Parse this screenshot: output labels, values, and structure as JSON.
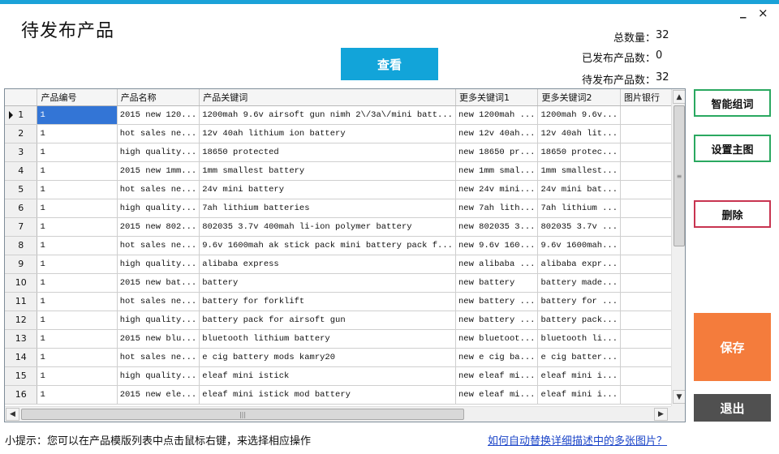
{
  "window": {
    "minimize_glyph": "_",
    "close_glyph": "×"
  },
  "page": {
    "title": "待发布产品"
  },
  "toolbar": {
    "view_label": "查看"
  },
  "stats": {
    "total_label": "总数量：",
    "total_value": "32",
    "published_label": "已发布产品数：",
    "published_value": "0",
    "pending_label": "待发布产品数：",
    "pending_value": "32"
  },
  "grid": {
    "columns": [
      "产品编号",
      "产品名称",
      "产品关键词",
      "更多关键词1",
      "更多关键词2",
      "图片银行"
    ],
    "current_row_icon": "row-pointer-icon",
    "rows": [
      {
        "num": "1",
        "id": "1",
        "name": "2015 new 120...",
        "kw": "1200mah 9.6v airsoft gun nimh 2\\/3a\\/mini batt...",
        "kw1": "new 1200mah ...",
        "kw2": "1200mah 9.6v...",
        "img": ""
      },
      {
        "num": "2",
        "id": "1",
        "name": "hot sales ne...",
        "kw": "12v 40ah lithium ion battery",
        "kw1": "new 12v 40ah...",
        "kw2": "12v 40ah lit...",
        "img": ""
      },
      {
        "num": "3",
        "id": "1",
        "name": "high quality...",
        "kw": "18650 protected",
        "kw1": "new 18650 pr...",
        "kw2": "18650 protec...",
        "img": ""
      },
      {
        "num": "4",
        "id": "1",
        "name": "2015 new 1mm...",
        "kw": "1mm smallest battery",
        "kw1": "new 1mm smal...",
        "kw2": "1mm smallest...",
        "img": ""
      },
      {
        "num": "5",
        "id": "1",
        "name": "hot sales ne...",
        "kw": "24v mini battery",
        "kw1": "new 24v mini...",
        "kw2": "24v mini bat...",
        "img": ""
      },
      {
        "num": "6",
        "id": "1",
        "name": "high quality...",
        "kw": "7ah lithium batteries",
        "kw1": "new 7ah lith...",
        "kw2": "7ah lithium ...",
        "img": ""
      },
      {
        "num": "7",
        "id": "1",
        "name": "2015 new 802...",
        "kw": "802035 3.7v 400mah li-ion polymer battery",
        "kw1": "new 802035 3...",
        "kw2": "802035 3.7v ...",
        "img": ""
      },
      {
        "num": "8",
        "id": "1",
        "name": "hot sales ne...",
        "kw": "9.6v 1600mah ak stick pack mini battery pack f...",
        "kw1": "new 9.6v 160...",
        "kw2": "9.6v 1600mah...",
        "img": ""
      },
      {
        "num": "9",
        "id": "1",
        "name": "high quality...",
        "kw": "alibaba express",
        "kw1": "new alibaba ...",
        "kw2": "alibaba expr...",
        "img": ""
      },
      {
        "num": "10",
        "id": "1",
        "name": "2015 new bat...",
        "kw": "battery",
        "kw1": "new battery",
        "kw2": "battery made...",
        "img": ""
      },
      {
        "num": "11",
        "id": "1",
        "name": "hot sales ne...",
        "kw": "battery for forklift",
        "kw1": "new battery ...",
        "kw2": "battery for ...",
        "img": ""
      },
      {
        "num": "12",
        "id": "1",
        "name": "high quality...",
        "kw": "battery pack for airsoft gun",
        "kw1": "new battery ...",
        "kw2": "battery pack...",
        "img": ""
      },
      {
        "num": "13",
        "id": "1",
        "name": "2015 new blu...",
        "kw": "bluetooth lithium battery",
        "kw1": "new bluetoot...",
        "kw2": "bluetooth li...",
        "img": ""
      },
      {
        "num": "14",
        "id": "1",
        "name": "hot sales ne...",
        "kw": "e cig battery mods kamry20",
        "kw1": "new e cig ba...",
        "kw2": "e cig batter...",
        "img": ""
      },
      {
        "num": "15",
        "id": "1",
        "name": "high quality...",
        "kw": "eleaf mini istick",
        "kw1": "new eleaf mi...",
        "kw2": "eleaf mini i...",
        "img": ""
      },
      {
        "num": "16",
        "id": "1",
        "name": "2015 new ele...",
        "kw": "eleaf mini istick mod battery",
        "kw1": "new eleaf mi...",
        "kw2": "eleaf mini i...",
        "img": ""
      }
    ]
  },
  "scrollbars": {
    "up_glyph": "▲",
    "down_glyph": "▼",
    "left_glyph": "◀",
    "right_glyph": "▶",
    "v_grip": "≡",
    "h_grip": "|||"
  },
  "side_buttons": {
    "smart_keywords": "智能组词",
    "set_main_image": "设置主图",
    "delete": "删除",
    "save": "保存",
    "exit": "退出"
  },
  "footer": {
    "tip": "小提示：您可以在产品模版列表中点击鼠标右键，来选择相应操作",
    "help_link": "如何自动替换详细描述中的多张图片？"
  },
  "colors": {
    "accent_blue": "#12a4d9",
    "selection": "#3375d6",
    "save_orange": "#f47c3c",
    "exit_gray": "#505050",
    "green_border": "#2aa860",
    "red_border": "#c83450",
    "link_blue": "#1a44c8"
  }
}
